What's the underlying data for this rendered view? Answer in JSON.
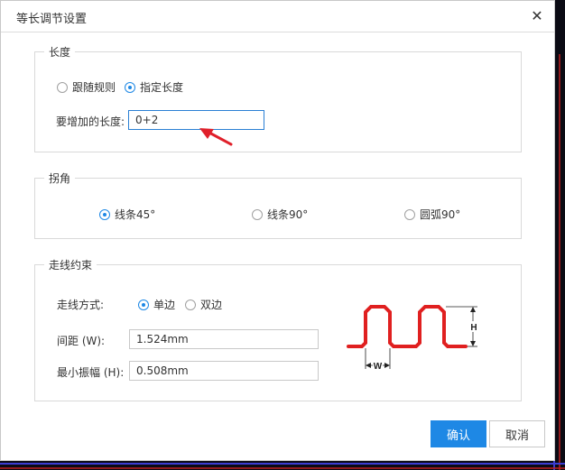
{
  "dialog": {
    "title": "等长调节设置",
    "close_glyph": "✕"
  },
  "length_group": {
    "title": "长度",
    "options": [
      {
        "label": "跟随规则",
        "selected": false
      },
      {
        "label": "指定长度",
        "selected": true
      }
    ],
    "add_length_label": "要增加的长度:",
    "add_length_value": "0+2"
  },
  "corner_group": {
    "title": "拐角",
    "options": [
      {
        "label": "线条45°",
        "selected": true
      },
      {
        "label": "线条90°",
        "selected": false
      },
      {
        "label": "圆弧90°",
        "selected": false
      }
    ]
  },
  "routing_group": {
    "title": "走线约束",
    "method_label": "走线方式:",
    "method_options": [
      {
        "label": "单边",
        "selected": true
      },
      {
        "label": "双边",
        "selected": false
      }
    ],
    "spacing_label": "间距 (W):",
    "spacing_value": "1.524mm",
    "amplitude_label": "最小振幅 (H):",
    "amplitude_value": "0.508mm",
    "diagram": {
      "h_label": "H",
      "w_label": "W",
      "trace_color": "#e02020"
    }
  },
  "buttons": {
    "confirm": "确认",
    "cancel": "取消"
  },
  "colors": {
    "accent": "#1e88e5",
    "annotation_arrow": "#e0202a"
  }
}
